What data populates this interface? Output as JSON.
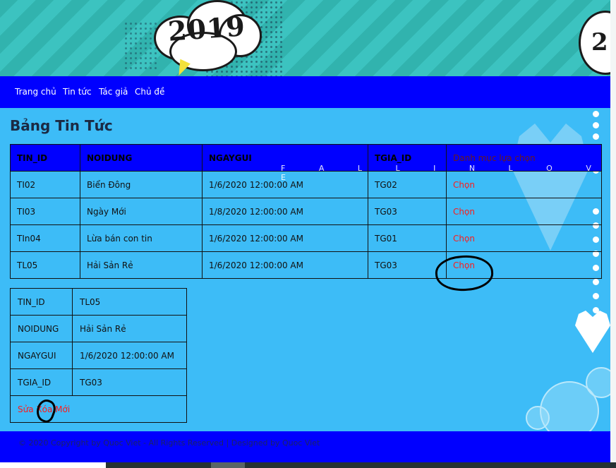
{
  "banner": {
    "year_left": "2019",
    "year_right": "2"
  },
  "nav": {
    "items": [
      "Trang chủ",
      "Tin tức",
      "Tác giả",
      "Chủ đề"
    ]
  },
  "title": "Bảng Tin Tức",
  "watermark": "F A L L I N L O V E",
  "main_table": {
    "headers": [
      "TIN_ID",
      "NOIDUNG",
      "NGAYGUI",
      "TGIA_ID",
      "Danh mục lựa chọn"
    ],
    "rows": [
      [
        "TI02",
        "Biển Đông",
        "1/6/2020 12:00:00 AM",
        "TG02",
        "Chọn"
      ],
      [
        "TI03",
        "Ngày Mới",
        "1/8/2020 12:00:00 AM",
        "TG03",
        "Chọn"
      ],
      [
        "TIn04",
        "Lừa bán con tin",
        "1/6/2020 12:00:00 AM",
        "TG01",
        "Chọn"
      ],
      [
        "TL05",
        "Hải Sản Rẻ",
        "1/6/2020 12:00:00 AM",
        "TG03",
        "Chọn"
      ]
    ]
  },
  "detail": {
    "rows": [
      [
        "TIN_ID",
        "TL05"
      ],
      [
        "NOIDUNG",
        "Hải Sản Rẻ"
      ],
      [
        "NGAYGUI",
        "1/6/2020 12:00:00 AM"
      ],
      [
        "TGIA_ID",
        "TG03"
      ]
    ],
    "actions": [
      "Sửa",
      "Xóa",
      "Mới"
    ]
  },
  "footer": "© 2020 Copyright by Quoc Viet - All Rights Reserved | Designed by Quoc Viet",
  "colors": {
    "nav": "#0000ff",
    "page_bg": "#3dbcf7",
    "link": "#ff1a1a"
  }
}
